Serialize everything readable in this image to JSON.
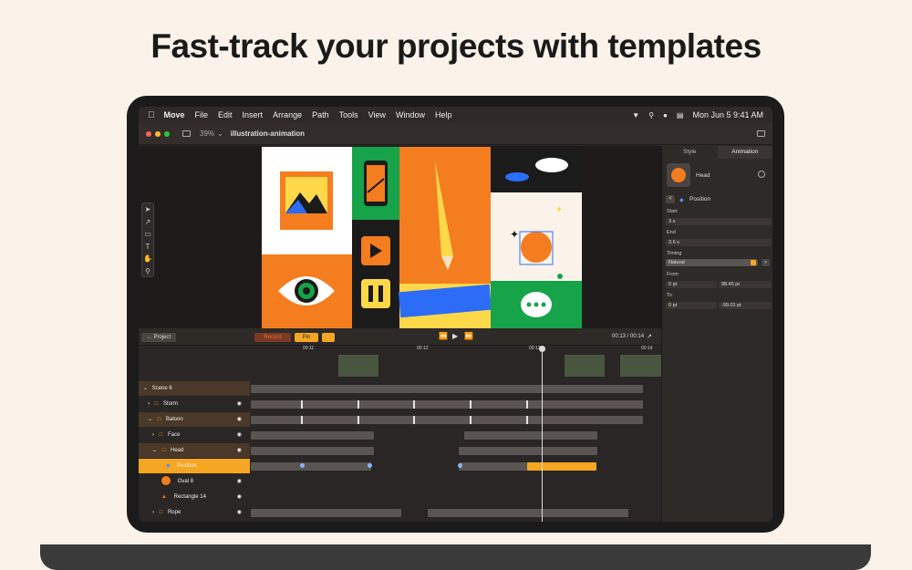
{
  "headline": "Fast-track your projects with templates",
  "menubar": {
    "app": "Move",
    "items": [
      "File",
      "Edit",
      "Insert",
      "Arrange",
      "Path",
      "Tools",
      "View",
      "Window",
      "Help"
    ],
    "clock": "Mon Jun 5  9:41 AM"
  },
  "toolbar": {
    "zoom": "39%",
    "doc_title": "illustration-animation"
  },
  "panel": {
    "tabs": [
      "Style",
      "Animation"
    ],
    "layer_name": "Head",
    "property": "Position",
    "start_label": "Start",
    "start_value": "3 s",
    "end_label": "End",
    "end_value": "3.6 s",
    "timing_label": "Timing",
    "timing_value": "Natural",
    "from_label": "From",
    "from_x": "0 pt",
    "from_y": "98.45 pt",
    "to_label": "To",
    "to_x": "0 pt",
    "to_y": "-99.01 pt"
  },
  "timeline": {
    "project_btn": "Project",
    "record_btn": "Record",
    "pin_btn": "Pin",
    "time": "00:13 / 00:14",
    "ruler": [
      "00:11",
      "00:12",
      "00:13",
      "00:14"
    ],
    "layers": [
      "Scene 6",
      "Storm",
      "Baloon",
      "Face",
      "Head",
      "Position",
      "Oval 8",
      "Rectangle 14",
      "Rope"
    ]
  }
}
